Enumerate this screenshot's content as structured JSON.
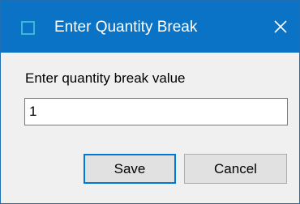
{
  "window": {
    "title": "Enter Quantity Break",
    "app_icon": "window-icon",
    "close_icon": "close-icon"
  },
  "form": {
    "prompt": "Enter quantity break value",
    "quantity_value": "1"
  },
  "buttons": {
    "save_label": "Save",
    "cancel_label": "Cancel"
  },
  "colors": {
    "titlebar": "#0a73c6",
    "accent": "#0078d7",
    "body": "#f0f0f0"
  }
}
